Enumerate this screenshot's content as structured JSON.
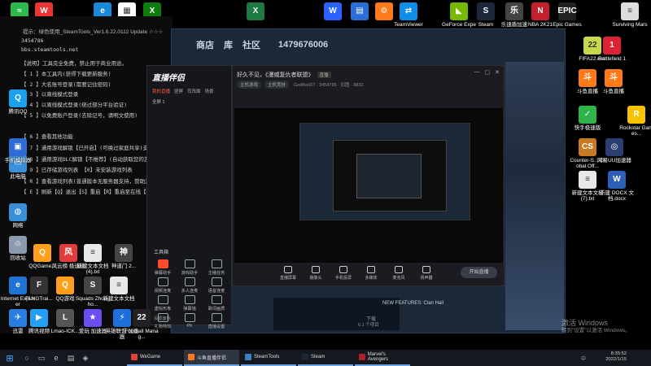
{
  "console": {
    "header": "提示：绿色使用_SteamTools_Ver1.6.22.0112 Update ☆☆☆",
    "id_value": "3454786",
    "url": "bbs.steamtools.net",
    "lines": [
      "【说明】工具完全免费，禁止用于商业用途。",
      "【 1 】本工具内(获得下载更新服务)",
      "【 2 】大名账号登录(需要记住密码)",
      "【 3 】以离线模式登录",
      "【 4 】以离线模式登录(绕过部分平台验证)",
      "【 5 】以免费账户登录(去除记号，请明文使用)",
      "【 6 】查看其他功能",
      "【 7 】通用游戏解锁【已开启】(可换过家庭共享)支持",
      "【 8 】通用游戏DLC解锁【不推荐】(自动获取您的游",
      "【 9 】已存储游戏列表  【0】未安装游戏列表",
      "【 R 】查看游戏列表(普通版本无服务器支持，赞助游",
      "【 E 】刷新【Q】退出【S】重启【R】重启至在线【R】"
    ]
  },
  "steam": {
    "nav": [
      "商店",
      "库",
      "社区"
    ],
    "account": "1479676006",
    "news_title": "NEW FEATURES: Clan Hall",
    "progress_label": "下载",
    "progress_value": "6.1 个项目"
  },
  "broadcast": {
    "logo": "直播伴侣",
    "tabs": [
      "我的直播",
      "竖屏",
      "司改面",
      "场景"
    ],
    "scene_label": "全屏 1",
    "tools_title": "工具箱",
    "tools": [
      "弹幕助手",
      "游戏助手",
      "主播任务",
      "视频连麦",
      "多人连麦",
      "语音连麦",
      "虚拟形象",
      "弹幕墙",
      "歌词画质",
      "礼物特效",
      "PK",
      "直播设置"
    ],
    "footer": "斗鱼直播伴侣使用教程",
    "footer2": "设置面板"
  },
  "preview": {
    "title": "好久不见，《漫威复仇者联盟》",
    "badge": "直播",
    "chips": [
      "主机游戏",
      "主机竞技"
    ],
    "meta": "GodBo007 · 3454785 · 旧图 · 8832",
    "controls": [
      "直播屏幕",
      "摄像头",
      "手机投屏",
      "多媒体",
      "麦克风",
      "扬声器"
    ],
    "start_label": "开始直播"
  },
  "desktop_icons": [
    {
      "label": "Internet Explorer",
      "color": "#1f73d6",
      "glyph": "e"
    },
    {
      "label": "FLNGTrai...",
      "color": "#333",
      "glyph": "F"
    },
    {
      "label": "QQ游戏",
      "color": "#ff9f1a",
      "glyph": "Q"
    },
    {
      "label": "Squads Zhongho...",
      "color": "#444",
      "glyph": "S"
    },
    {
      "label": "新建文本文档",
      "color": "#e8e8e8",
      "glyph": "≡"
    },
    {
      "label": "迅雷",
      "color": "#2a7de1",
      "glyph": "✈"
    },
    {
      "label": "腾讯视频",
      "color": "#23a0f4",
      "glyph": "▶"
    },
    {
      "label": "Lmao-ICK...",
      "color": "#555",
      "glyph": "L"
    },
    {
      "label": "爱玩 加速器",
      "color": "#6b4df0",
      "glyph": "★"
    },
    {
      "label": "英雄联盟 加速器",
      "color": "#1e6fd9",
      "glyph": "⚡"
    },
    {
      "label": "Football Manag...",
      "color": "#222",
      "glyph": "22"
    },
    {
      "label": "此电脑",
      "color": "#3a8fd9",
      "glyph": "▭"
    },
    {
      "label": "网络",
      "color": "#3a8fd9",
      "glyph": "◍"
    },
    {
      "label": "回收站",
      "color": "#8a9bb0",
      "glyph": "♲"
    },
    {
      "label": "腾讯QQ",
      "color": "#1aa0f0",
      "glyph": "Q"
    },
    {
      "label": "手机模拟器",
      "color": "#2f6bd6",
      "glyph": "▣"
    },
    {
      "label": "QQGame...",
      "color": "#ff9f1a",
      "glyph": "Q"
    },
    {
      "label": "风云榜 极速版",
      "color": "#e23b3b",
      "glyph": "风"
    },
    {
      "label": "新建文本文档 (4).txt",
      "color": "#e8e8e8",
      "glyph": "≡"
    },
    {
      "label": "神道门 2...",
      "color": "#444",
      "glyph": "神"
    }
  ],
  "right_icons": [
    {
      "label": "Surviving Mars",
      "color": "#ddd",
      "glyph": "≡"
    },
    {
      "label": "FIFA22.exe",
      "color": "#c8d84a",
      "glyph": "22"
    },
    {
      "label": "Battlefield 1",
      "color": "#d23",
      "glyph": "1"
    },
    {
      "label": "斗鱼直播",
      "color": "#ff7a1a",
      "glyph": "斗"
    },
    {
      "label": "斗鱼直播",
      "color": "#ff7a1a",
      "glyph": "斗"
    },
    {
      "label": "快手极速版",
      "color": "#2fb44a",
      "glyph": "✓"
    },
    {
      "label": "Rockstar Games...",
      "color": "#f7c300",
      "glyph": "R"
    },
    {
      "label": "Counter-S... Global Off...",
      "color": "#c87a22",
      "glyph": "CS"
    },
    {
      "label": "网易UU加速器",
      "color": "#2c3e70",
      "glyph": "◎"
    },
    {
      "label": "新建文本文档 (7).txt",
      "color": "#e8e8e8",
      "glyph": "≡"
    },
    {
      "label": "新建 DOCX 文档.docx",
      "color": "#2b5fb8",
      "glyph": "W"
    }
  ],
  "top_icons": [
    {
      "label": "WeChat",
      "color": "#2db84c",
      "glyph": "≈"
    },
    {
      "label": "Wps",
      "color": "#e33",
      "glyph": "W"
    },
    {
      "label": "Edge",
      "color": "#1a8ad8",
      "glyph": "e"
    },
    {
      "label": "QR",
      "color": "#fff",
      "glyph": "▦"
    },
    {
      "label": "Xbox",
      "color": "#107c10",
      "glyph": "X"
    },
    {
      "label": "Excel",
      "color": "#1d7a44",
      "glyph": "X"
    },
    {
      "label": "WPS",
      "color": "#2962ff",
      "glyph": "W"
    },
    {
      "label": "Boxes",
      "color": "#2b6fd6",
      "glyph": "▤"
    },
    {
      "label": "Orange",
      "color": "#ff7a1a",
      "glyph": "⚙"
    },
    {
      "label": "TeamViewer",
      "color": "#0e8ee9",
      "glyph": "⇄"
    },
    {
      "label": "GeForce Experience",
      "color": "#76b900",
      "glyph": "◣"
    },
    {
      "label": "Steam",
      "color": "#1b2838",
      "glyph": "S"
    },
    {
      "label": "乐速盾加速",
      "color": "#444",
      "glyph": "乐"
    },
    {
      "label": "NBA 2K21",
      "color": "#c3202b",
      "glyph": "N"
    },
    {
      "label": "Epic Games",
      "color": "#222",
      "glyph": "EPIC"
    }
  ],
  "taskbar": {
    "apps": [
      {
        "label": "WeGame",
        "color": "#e0423b",
        "active": false
      },
      {
        "label": "斗鱼直播伴侣",
        "color": "#ff7a1a",
        "active": true
      },
      {
        "label": "SteamTools",
        "color": "#3b82c4",
        "active": false
      },
      {
        "label": "Steam",
        "color": "#1b2838",
        "active": false
      },
      {
        "label": "Marvel's Avengers",
        "color": "#b0202b",
        "active": false
      }
    ],
    "time": "8:35:52",
    "date": "2022/1/15",
    "lang": "中"
  },
  "watermark": {
    "line1": "激活 Windows",
    "line2": "转到\"设置\"以激活 Windows。"
  },
  "colors": {
    "accent": "#ff4a2b",
    "steam_bg": "#1b2838",
    "taskbar": "#15191f"
  }
}
